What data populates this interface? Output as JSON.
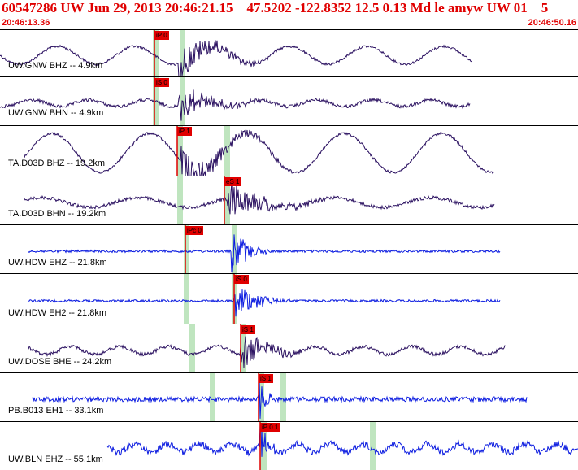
{
  "header": {
    "title": "60547286 UW Jun 29, 2013 20:46:21.15    47.5202 -122.8352 12.5 0.13 Md le amyw UW 01    5",
    "start_time": "20:46:13.36",
    "end_time": "20:46:50.16"
  },
  "colors": {
    "title": "#e00000",
    "trace_broadband": "#2a1060",
    "trace_short_period": "#0a1ae0",
    "pick_flag": "#e00000",
    "window_bar": "#bfe5bf"
  },
  "traces": [
    {
      "label": "UW.GNW BHZ -- 4.9km",
      "pick": "iP 0",
      "color": "broadband"
    },
    {
      "label": "UW.GNW BHN -- 4.9km",
      "pick": "iS 0",
      "color": "broadband"
    },
    {
      "label": "TA.D03D BHZ -- 19.2km",
      "pick": "iP 1",
      "color": "broadband"
    },
    {
      "label": "TA.D03D BHN -- 19.2km",
      "pick": "eS 1",
      "color": "broadband"
    },
    {
      "label": "UW.HDW EHZ -- 21.8km",
      "pick": "iPc 0",
      "color": "short_period"
    },
    {
      "label": "UW.HDW EH2 -- 21.8km",
      "pick": "iS 0",
      "color": "short_period"
    },
    {
      "label": "UW.DOSE BHE -- 24.2km",
      "pick": "iS 1",
      "color": "broadband"
    },
    {
      "label": "PB.B013 EH1 -- 33.1km",
      "pick": "iS 1",
      "color": "short_period"
    },
    {
      "label": "UW.BLN EHZ -- 55.1km",
      "pick": "iP 0 1",
      "color": "short_period"
    }
  ]
}
